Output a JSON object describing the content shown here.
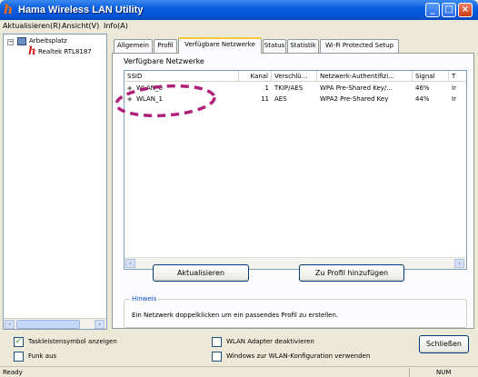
{
  "window": {
    "title": "Hama Wireless LAN Utility"
  },
  "menu": [
    "Aktualisieren(R)",
    "Ansicht(V)",
    "Info(A)"
  ],
  "tree": {
    "root": "Arbeitsplatz",
    "adapter": "Realtek RTL8187"
  },
  "tabs": [
    "Allgemein",
    "Profil",
    "Verfügbare Netzwerke",
    "Status",
    "Statistik",
    "Wi-Fi Protected Setup"
  ],
  "available_networks": {
    "section_label": "Verfügbare Netzwerke",
    "columns": [
      "SSID",
      "Kanal",
      "Verschlü...",
      "Netzwerk-Authentifizi...",
      "Signal",
      "T"
    ],
    "rows": [
      {
        "ssid": "WLAN_0",
        "channel": "1",
        "encryption": "TKIP/AES",
        "auth": "WPA Pre-Shared Key/...",
        "signal": "46%",
        "type": "Ir"
      },
      {
        "ssid": "WLAN_1",
        "channel": "11",
        "encryption": "AES",
        "auth": "WPA2 Pre-Shared Key",
        "signal": "44%",
        "type": "Ir"
      }
    ],
    "refresh_button": "Aktualisieren",
    "add_profile_button": "Zu Profil hinzufügen",
    "hint_title": "Hinweis",
    "hint_text": "Ein Netzwerk doppelklicken um ein passendes Profil zu erstellen."
  },
  "options": [
    {
      "label": "Taskleistensymbol anzeigen",
      "checked": true
    },
    {
      "label": "Funk aus",
      "checked": false
    },
    {
      "label": "WLAN Adapter deaktivieren",
      "checked": false
    },
    {
      "label": "Windows zur WLAN-Konfiguration verwenden",
      "checked": false
    }
  ],
  "close_button": "Schließen",
  "statusbar": {
    "left": "Ready",
    "right": "NUM"
  },
  "colors": {
    "titlebar": "#0553d4",
    "annotation": "#b0207a",
    "tab_highlight": "#ffc83c"
  }
}
